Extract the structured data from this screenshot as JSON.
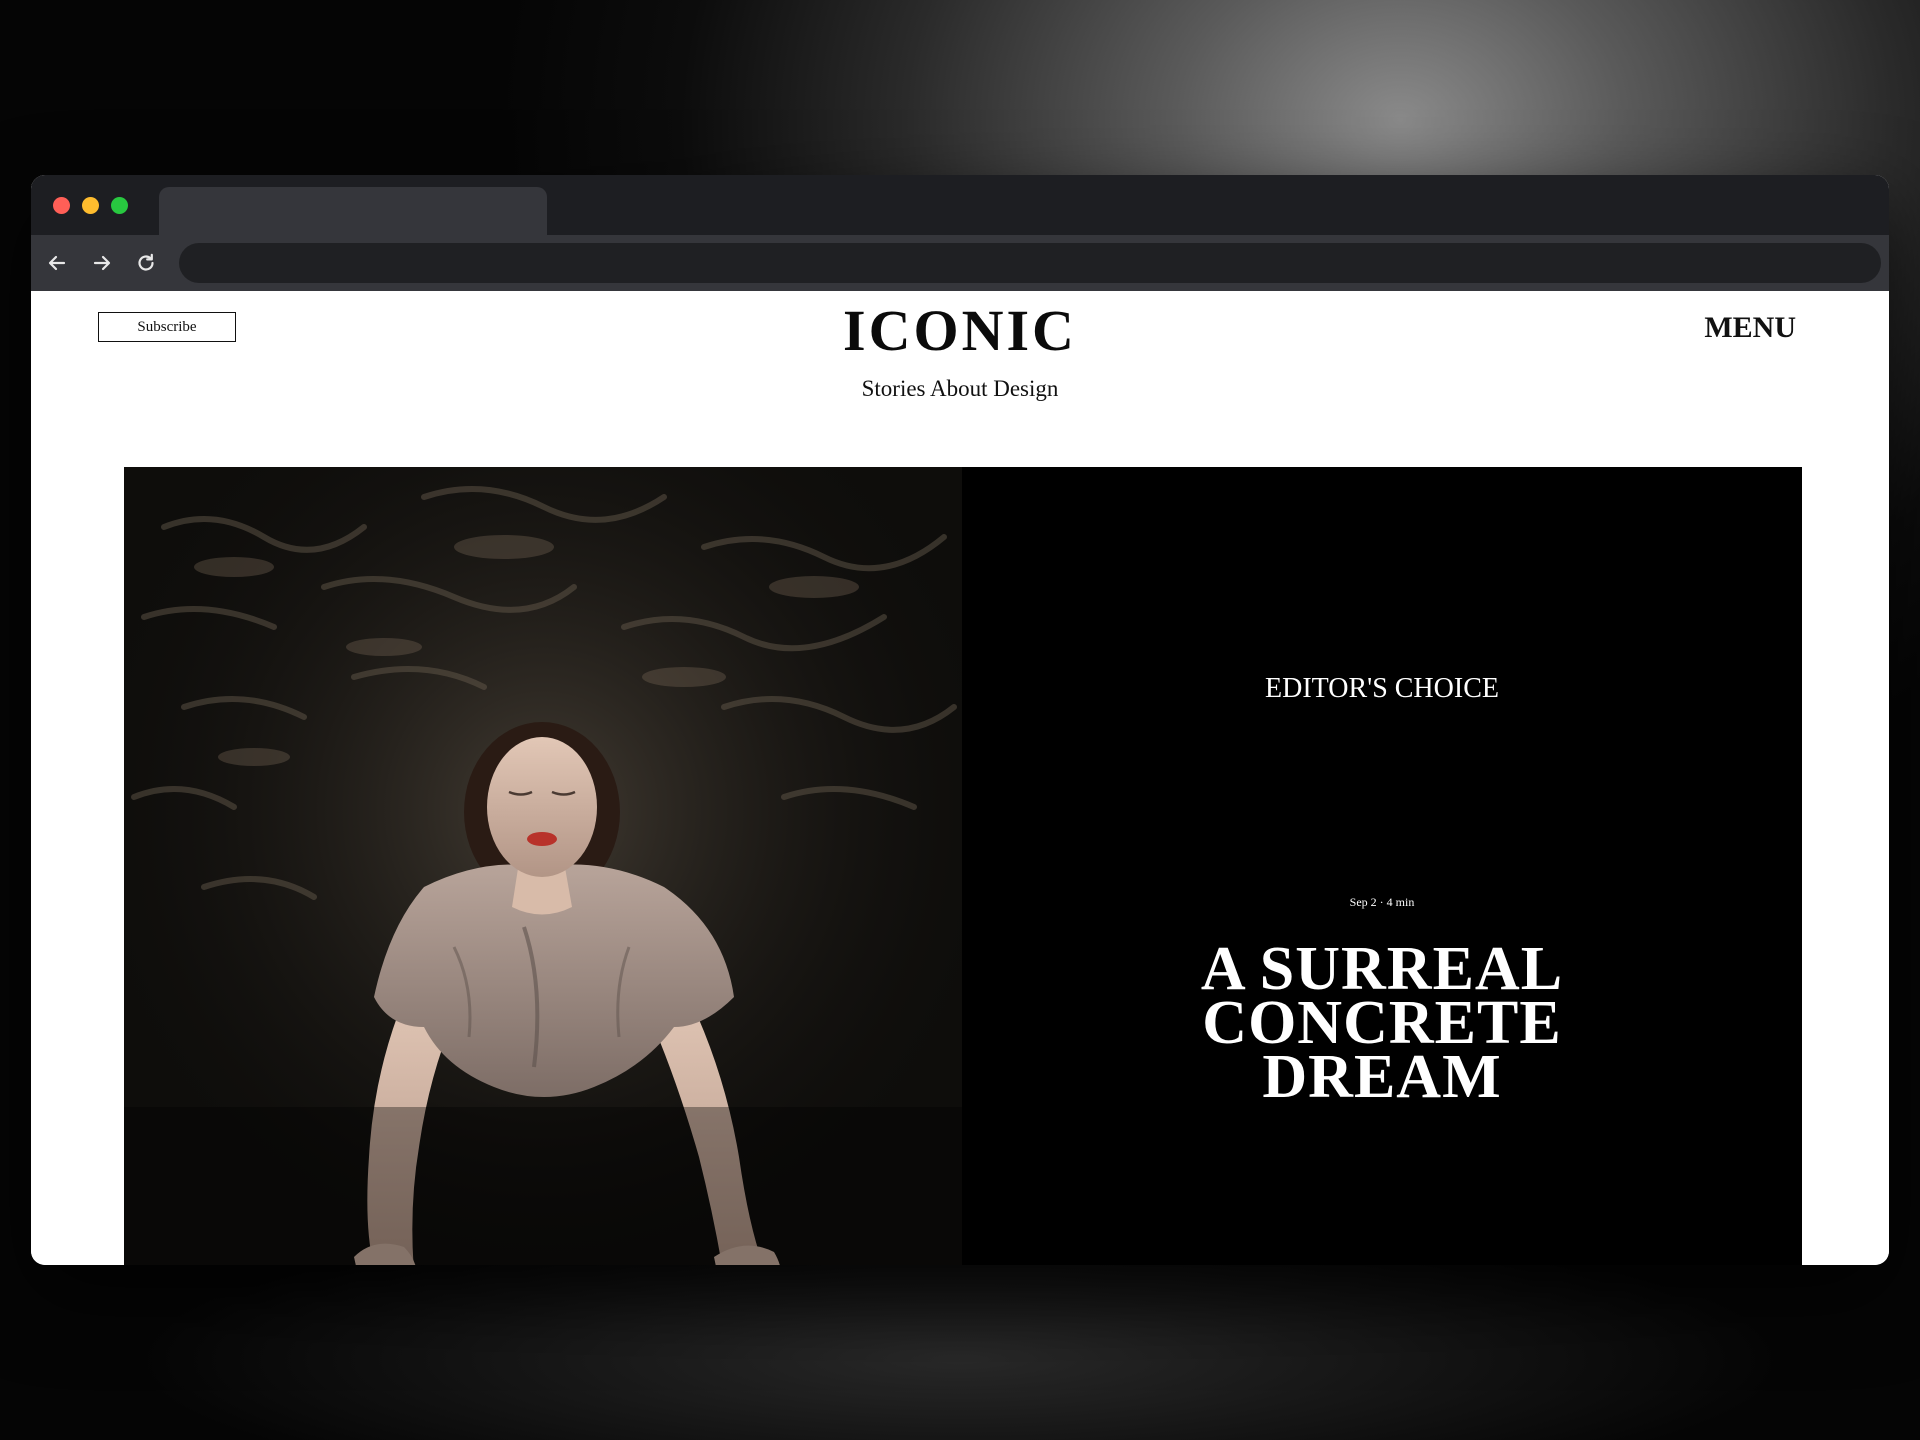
{
  "browser": {
    "traffic_lights": [
      {
        "name": "close",
        "color": "#ff5f57"
      },
      {
        "name": "minimize",
        "color": "#febc2e"
      },
      {
        "name": "maximize",
        "color": "#28c840"
      }
    ],
    "tab_title": "",
    "address": "",
    "icons": {
      "back": "arrow-left-icon",
      "forward": "arrow-right-icon",
      "reload": "reload-icon"
    }
  },
  "header": {
    "subscribe_label": "Subscribe",
    "brand": "ICONIC",
    "tagline": "Stories About Design",
    "menu_label": "MENU"
  },
  "hero": {
    "image": "woman-in-dark-water-photo",
    "section_label": "EDITOR'S CHOICE",
    "meta": "Sep 2 · 4 min",
    "headline_lines": [
      "A SURREAL",
      "CONCRETE",
      "DREAM"
    ]
  },
  "colors": {
    "page_background": "#ffffff",
    "panel_background": "#000000",
    "chrome_dark": "#1d1e22",
    "chrome_toolbar": "#35363b"
  }
}
